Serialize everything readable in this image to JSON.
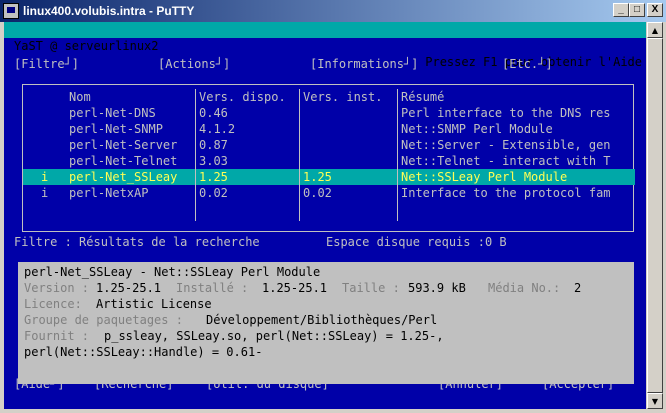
{
  "window": {
    "title": "linux400.volubis.intra - PuTTY",
    "controls": [
      "_",
      "□",
      "X"
    ]
  },
  "header": {
    "left": "YaST @ serveurlinux2",
    "right": "Pressez F1 pour obtenir l'Aide"
  },
  "menu": [
    {
      "label": "[Filtre┘]"
    },
    {
      "label": "[Actions┘]"
    },
    {
      "label": "[Informations┘]"
    },
    {
      "label": "[Etc.┘]"
    }
  ],
  "table": {
    "columns": [
      "Nom",
      "Vers. dispo.",
      "Vers. inst.",
      "Résumé"
    ],
    "rows": [
      {
        "status": "",
        "name": "perl-Net-DNS",
        "avail": "0.46",
        "inst": "",
        "summary": "Perl interface to the DNS res"
      },
      {
        "status": "",
        "name": "perl-Net-SNMP",
        "avail": "4.1.2",
        "inst": "",
        "summary": "Net::SNMP Perl Module"
      },
      {
        "status": "",
        "name": "perl-Net-Server",
        "avail": "0.87",
        "inst": "",
        "summary": "Net::Server - Extensible, gen"
      },
      {
        "status": "",
        "name": "perl-Net-Telnet",
        "avail": "3.03",
        "inst": "",
        "summary": "Net::Telnet - interact with T"
      },
      {
        "status": "i",
        "name": "perl-Net_SSLeay",
        "avail": "1.25",
        "inst": "1.25",
        "summary": "Net::SSLeay Perl Module",
        "selected": true
      },
      {
        "status": "i",
        "name": "perl-NetxAP",
        "avail": "0.02",
        "inst": "0.02",
        "summary": "Interface to the protocol fam"
      }
    ]
  },
  "filter": {
    "label": "Filtre : Résultats de la recherche",
    "disk": "Espace disque requis :0 B"
  },
  "details": {
    "line1": "perl-Net_SSLeay - Net::SSLeay Perl Module",
    "version_label": "Version :",
    "version_value": "1.25-25.1",
    "installed_label": "Installé :",
    "installed_value": "1.25-25.1",
    "size_label": "Taille :",
    "size_value": "593.9 kB",
    "media_label": "Média No.:",
    "media_value": "2",
    "license_label": "Licence:",
    "license_value": "Artistic License",
    "group_label": "Groupe de paquetages :",
    "group_value": "Développement/Bibliothèques/Perl",
    "provides_label": "Fournit :",
    "provides_value": "p_ssleay, SSLeay.so, perl(Net::SSLeay) = 1.25-,",
    "provides_cont": "perl(Net::SSLeay::Handle) = 0.61-"
  },
  "buttons": {
    "aide": "[Aide┘]",
    "recherche": "[Recherche]",
    "util": "[Util. du disque]",
    "annuler": "[Annuler]",
    "accepter": "[Accepter]"
  },
  "colors": {
    "terminal_bg": "#0000a8",
    "terminal_fg": "#c0c0c0",
    "highlight_bg": "#00a8a8",
    "highlight_fg": "#ffff55"
  }
}
